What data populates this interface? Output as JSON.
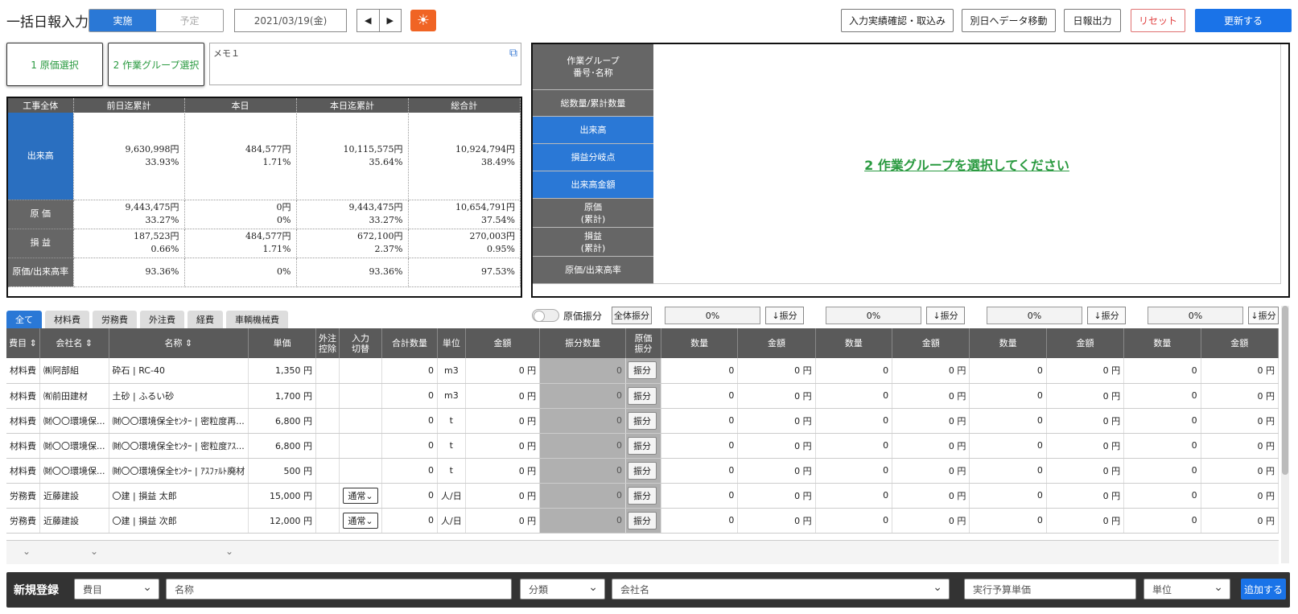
{
  "header": {
    "title": "一括日報入力",
    "mode_active": "実施",
    "mode_inactive": "予定",
    "date": "2021/03/19(金)",
    "prev": "◀",
    "next": "▶",
    "sun": "☀",
    "btn_confirm": "入力実績確認・取込み",
    "btn_move": "別日へデータ移動",
    "btn_output": "日報出力",
    "btn_reset": "リセット",
    "btn_update": "更新する"
  },
  "select": {
    "cost": "1 原価選択",
    "group": "2 作業グループ選択",
    "memo": "メモ１",
    "ext": "⧉"
  },
  "summary": {
    "headers": [
      "工事全体",
      "前日迄累計",
      "本日",
      "本日迄累計",
      "総合計"
    ],
    "rows": [
      {
        "label": "出来高",
        "cells": [
          [
            "9,630,998円",
            "33.93%"
          ],
          [
            "484,577円",
            "1.71%"
          ],
          [
            "10,115,575円",
            "35.64%"
          ],
          [
            "10,924,794円",
            "38.49%"
          ]
        ]
      },
      {
        "label": "原 価",
        "cells": [
          [
            "9,443,475円",
            "33.27%"
          ],
          [
            "0円",
            "0%"
          ],
          [
            "9,443,475円",
            "33.27%"
          ],
          [
            "10,654,791円",
            "37.54%"
          ]
        ]
      },
      {
        "label": "損 益",
        "cells": [
          [
            "187,523円",
            "0.66%"
          ],
          [
            "484,577円",
            "1.71%"
          ],
          [
            "672,100円",
            "2.37%"
          ],
          [
            "270,003円",
            "0.95%"
          ]
        ]
      },
      {
        "label": "原価/出来高率",
        "cells": [
          [
            "93.36%"
          ],
          [
            "0%"
          ],
          [
            "93.36%"
          ],
          [
            "97.53%"
          ]
        ]
      }
    ]
  },
  "right": {
    "labels": [
      "作業グループ\n番号･名称",
      "総数量/累計数量",
      "出来高",
      "損益分岐点",
      "出来高金額",
      "原価\n(累計)",
      "損益\n(累計)",
      "原価/出来高率"
    ],
    "message": "2 作業グループを選択してください"
  },
  "tabs": [
    "全て",
    "材料費",
    "労務費",
    "外注費",
    "経費",
    "車輌機械費"
  ],
  "toolbar": {
    "toggle_label": "原価振分",
    "all_dist": "全体振分",
    "pct": "0%",
    "dist": "↓振分"
  },
  "grid": {
    "headers": [
      "費目 ⇕",
      "会社名 ⇕",
      "名称 ⇕",
      "単価",
      "外注\n控除",
      "入力\n切替",
      "合計数量",
      "単位",
      "金額",
      "振分数量",
      "原価\n振分",
      "数量",
      "金額",
      "数量",
      "金額",
      "数量",
      "金額",
      "数量",
      "金額"
    ],
    "rows": [
      {
        "cat": "材料費",
        "co": "㈱阿部組",
        "name": "砕石 | RC-40",
        "price": "1,350 円",
        "sw": "",
        "qty": "0",
        "unit": "m3",
        "amt": "0 円",
        "dq": "0"
      },
      {
        "cat": "材料費",
        "co": "㈲前田建材",
        "name": "土砂 | ふるい砂",
        "price": "1,700 円",
        "sw": "",
        "qty": "0",
        "unit": "m3",
        "amt": "0 円",
        "dq": "0"
      },
      {
        "cat": "材料費",
        "co": "㈶〇〇環境保...",
        "name": "㈶〇〇環境保全ｾﾝﾀｰ | 密粒度再...",
        "price": "6,800 円",
        "sw": "",
        "qty": "0",
        "unit": "t",
        "amt": "0 円",
        "dq": "0"
      },
      {
        "cat": "材料費",
        "co": "㈶〇〇環境保...",
        "name": "㈶〇〇環境保全ｾﾝﾀｰ | 密粒度ｱｽ...",
        "price": "6,800 円",
        "sw": "",
        "qty": "0",
        "unit": "t",
        "amt": "0 円",
        "dq": "0"
      },
      {
        "cat": "材料費",
        "co": "㈶〇〇環境保...",
        "name": "㈶〇〇環境保全ｾﾝﾀｰ | ｱｽﾌｧﾙﾄ廃材",
        "price": "500 円",
        "sw": "",
        "qty": "0",
        "unit": "t",
        "amt": "0 円",
        "dq": "0"
      },
      {
        "cat": "労務費",
        "co": "近藤建設",
        "name": "〇建 | 損益 太郎",
        "price": "15,000 円",
        "sw": "通常⌄",
        "qty": "0",
        "unit": "人/日",
        "amt": "0 円",
        "dq": "0"
      },
      {
        "cat": "労務費",
        "co": "近藤建設",
        "name": "〇建 | 損益 次郎",
        "price": "12,000 円",
        "sw": "通常⌄",
        "qty": "0",
        "unit": "人/日",
        "amt": "0 円",
        "dq": "0"
      }
    ],
    "btn": "振分",
    "gq": "0",
    "ga": "0 円"
  },
  "bottom": {
    "label": "新規登録",
    "item": "費目",
    "name": "名称",
    "class": "分類",
    "company": "会社名",
    "price": "実行予算単価",
    "unit": "単位",
    "add": "追加する",
    "chev": "⌄"
  }
}
